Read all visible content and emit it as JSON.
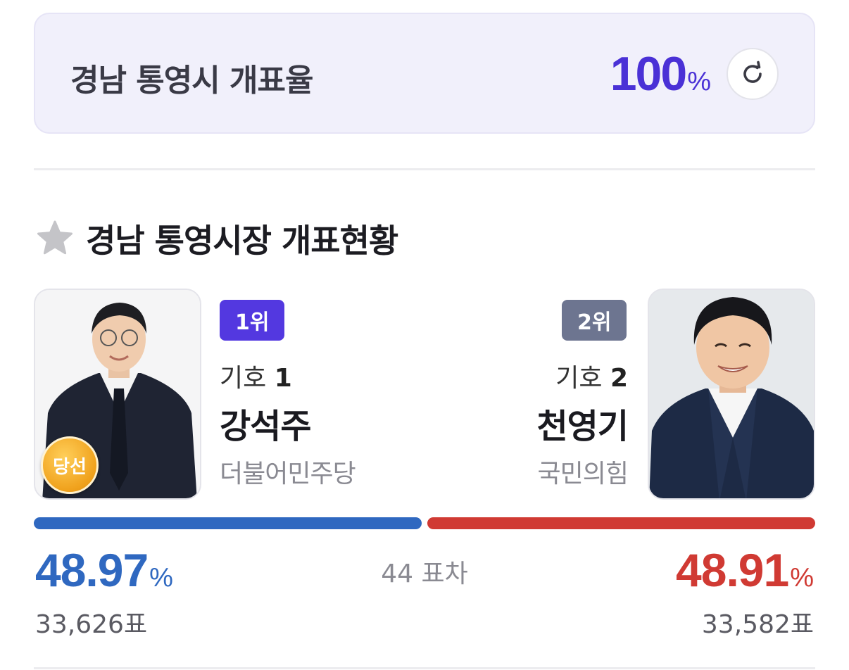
{
  "turnout": {
    "label": "경남 통영시 개표율",
    "value": "100",
    "unit": "%"
  },
  "section": {
    "title": "경남 통영시장 개표현황"
  },
  "win_badge": "당선",
  "candidates": [
    {
      "rank": "1위",
      "number_label": "기호",
      "number": "1",
      "name": "강석주",
      "party": "더불어민주당",
      "percent": "48.97",
      "percent_unit": "%",
      "votes": "33,626표",
      "share": 48.97,
      "color": "#2f68c0"
    },
    {
      "rank": "2위",
      "number_label": "기호",
      "number": "2",
      "name": "천영기",
      "party": "국민의힘",
      "percent": "48.91",
      "percent_unit": "%",
      "votes": "33,582표",
      "share": 48.91,
      "color": "#d03a33"
    }
  ],
  "margin": "44 표차",
  "colors": {
    "accent": "#4a31d6",
    "rank1": "#5338e0",
    "rank2": "#6d7590",
    "win_badge": "#f0a11c"
  }
}
